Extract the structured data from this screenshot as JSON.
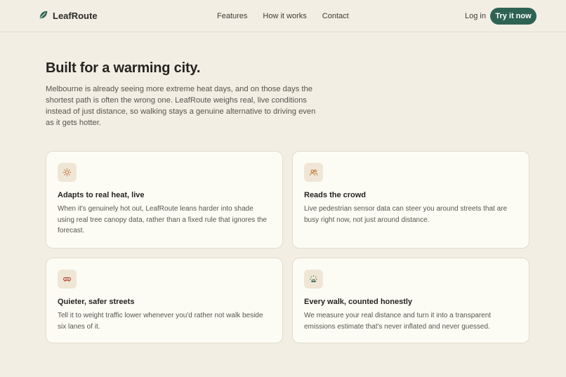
{
  "nav": {
    "brand": "LeafRoute",
    "links": [
      "Features",
      "How it works",
      "Contact"
    ],
    "login": "Log in",
    "cta": "Try it now"
  },
  "hero": {
    "title": "Built for a warming city.",
    "text": "Melbourne is already seeing more extreme heat days, and on those days the shortest path is often the wrong one. LeafRoute weighs real, live conditions instead of just distance, so walking stays a genuine alternative to driving even as it gets hotter."
  },
  "features": [
    {
      "icon": "sun-icon",
      "icon_color": "#c7743e",
      "title": "Adapts to real heat, live",
      "desc": "When it's genuinely hot out, LeafRoute leans harder into shade using real tree canopy data, rather than a fixed rule that ignores the forecast."
    },
    {
      "icon": "people-icon",
      "icon_color": "#b9782f",
      "title": "Reads the crowd",
      "desc": "Live pedestrian sensor data can steer you around streets that are busy right now, not just around distance."
    },
    {
      "icon": "car-icon",
      "icon_color": "#b8402f",
      "title": "Quieter, safer streets",
      "desc": "Tell it to weight traffic lower whenever you'd rather not walk beside six lanes of it."
    },
    {
      "icon": "emissions-icon",
      "icon_color": "#2e6354",
      "title": "Every walk, counted honestly",
      "desc": "We measure your real distance and turn it into a transparent emissions estimate that's never inflated and never guessed."
    }
  ]
}
